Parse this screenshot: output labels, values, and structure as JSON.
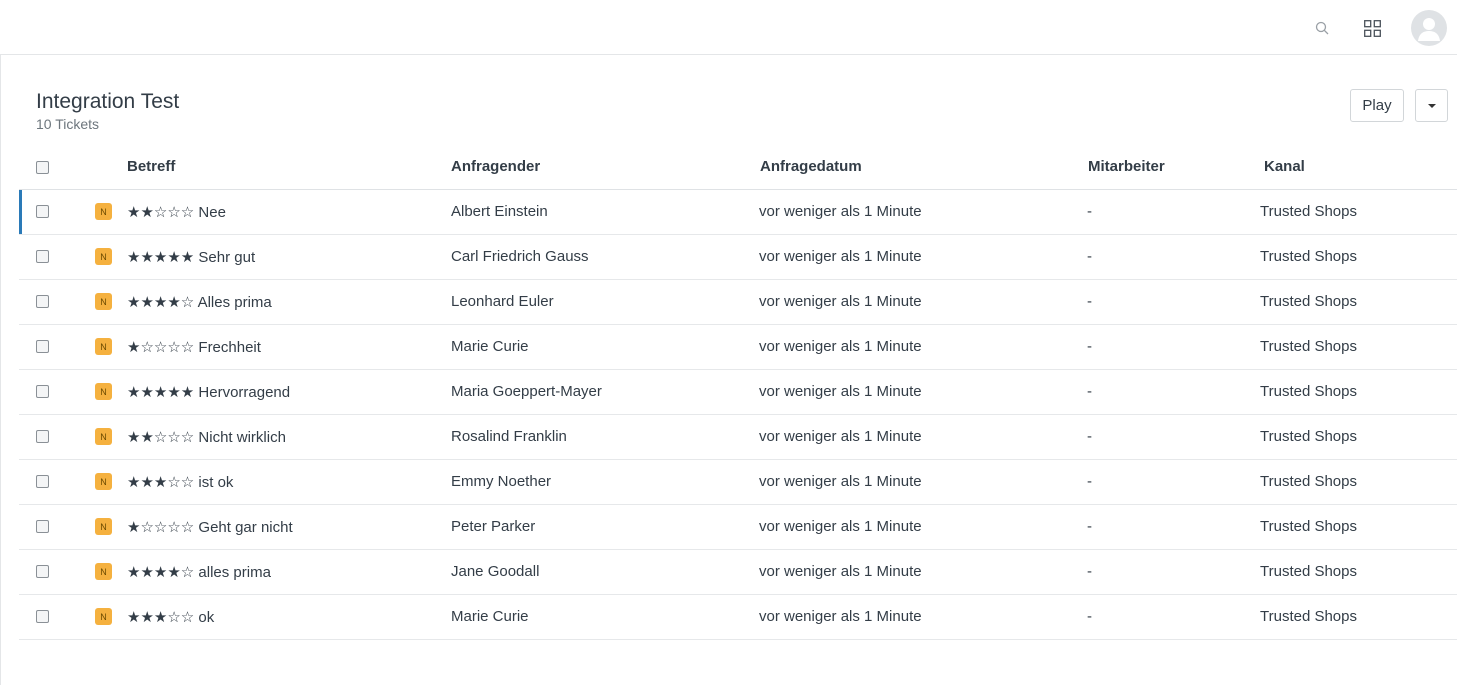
{
  "header": {
    "search_icon": "search-icon",
    "apps_icon": "grid-icon",
    "avatar_icon": "user-icon"
  },
  "view": {
    "title": "Integration Test",
    "count_label": "10 Tickets",
    "play_label": "Play"
  },
  "table": {
    "columns": {
      "subject": "Betreff",
      "requester": "Anfragender",
      "date": "Anfragedatum",
      "staff": "Mitarbeiter",
      "channel": "Kanal"
    },
    "rows": [
      {
        "badge": "N",
        "subject": "★★☆☆☆ Nee",
        "requester": "Albert Einstein",
        "date": "vor weniger als 1 Minute",
        "staff": "-",
        "channel": "Trusted Shops"
      },
      {
        "badge": "N",
        "subject": "★★★★★ Sehr gut",
        "requester": "Carl Friedrich Gauss",
        "date": "vor weniger als 1 Minute",
        "staff": "-",
        "channel": "Trusted Shops"
      },
      {
        "badge": "N",
        "subject": "★★★★☆ Alles prima",
        "requester": "Leonhard Euler",
        "date": "vor weniger als 1 Minute",
        "staff": "-",
        "channel": "Trusted Shops"
      },
      {
        "badge": "N",
        "subject": "★☆☆☆☆ Frechheit",
        "requester": "Marie Curie",
        "date": "vor weniger als 1 Minute",
        "staff": "-",
        "channel": "Trusted Shops"
      },
      {
        "badge": "N",
        "subject": "★★★★★ Hervorragend",
        "requester": "Maria Goeppert-Mayer",
        "date": "vor weniger als 1 Minute",
        "staff": "-",
        "channel": "Trusted Shops"
      },
      {
        "badge": "N",
        "subject": "★★☆☆☆ Nicht wirklich",
        "requester": "Rosalind Franklin",
        "date": "vor weniger als 1 Minute",
        "staff": "-",
        "channel": "Trusted Shops"
      },
      {
        "badge": "N",
        "subject": "★★★☆☆ ist ok",
        "requester": "Emmy Noether",
        "date": "vor weniger als 1 Minute",
        "staff": "-",
        "channel": "Trusted Shops"
      },
      {
        "badge": "N",
        "subject": "★☆☆☆☆ Geht gar nicht",
        "requester": "Peter Parker",
        "date": "vor weniger als 1 Minute",
        "staff": "-",
        "channel": "Trusted Shops"
      },
      {
        "badge": "N",
        "subject": "★★★★☆ alles prima",
        "requester": "Jane Goodall",
        "date": "vor weniger als 1 Minute",
        "staff": "-",
        "channel": "Trusted Shops"
      },
      {
        "badge": "N",
        "subject": "★★★☆☆ ok",
        "requester": "Marie Curie",
        "date": "vor weniger als 1 Minute",
        "staff": "-",
        "channel": "Trusted Shops"
      }
    ]
  },
  "colors": {
    "badge_bg": "#f5b13f",
    "active_row_marker": "#2a7ab8"
  }
}
